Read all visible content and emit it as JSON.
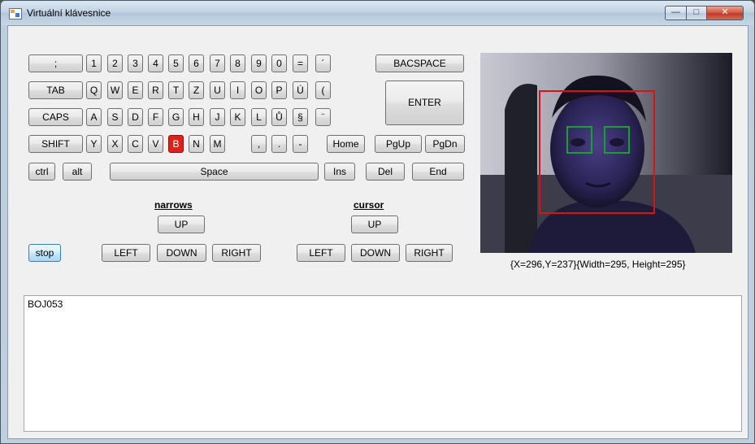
{
  "window": {
    "title": "Virtuální klávesnice",
    "controls": {
      "minimize": "—",
      "maximize": "□",
      "close": "✕"
    }
  },
  "keyboard": {
    "row1": [
      ";",
      "1",
      "2",
      "3",
      "4",
      "5",
      "6",
      "7",
      "8",
      "9",
      "0",
      "=",
      "´",
      "BACSPACE"
    ],
    "row2": [
      "TAB",
      "Q",
      "W",
      "E",
      "R",
      "T",
      "Z",
      "U",
      "I",
      "O",
      "P",
      "Ú",
      "("
    ],
    "enter": "ENTER",
    "row3": [
      "CAPS",
      "A",
      "S",
      "D",
      "F",
      "G",
      "H",
      "J",
      "K",
      "L",
      "Ů",
      "§",
      "¨"
    ],
    "row4": [
      "SHIFT",
      "Y",
      "X",
      "C",
      "V",
      "B",
      "N",
      "M",
      ",",
      ".",
      "-",
      "Home",
      "PgUp",
      "PgDn"
    ],
    "row5": [
      "ctrl",
      "alt",
      "Space",
      "Ins",
      "Del",
      "End"
    ],
    "highlighted_key": "B"
  },
  "narrows": {
    "label": "narrows",
    "up": "UP",
    "left": "LEFT",
    "down": "DOWN",
    "right": "RIGHT"
  },
  "cursor": {
    "label": "cursor",
    "up": "UP",
    "left": "LEFT",
    "down": "DOWN",
    "right": "RIGHT"
  },
  "stop_button": "stop",
  "camera": {
    "detection_text": "{X=296,Y=237}{Width=295, Height=295}",
    "face_box_color": "#e01010",
    "eye_box_color": "#19a030"
  },
  "output": {
    "text": "BOJ053"
  }
}
